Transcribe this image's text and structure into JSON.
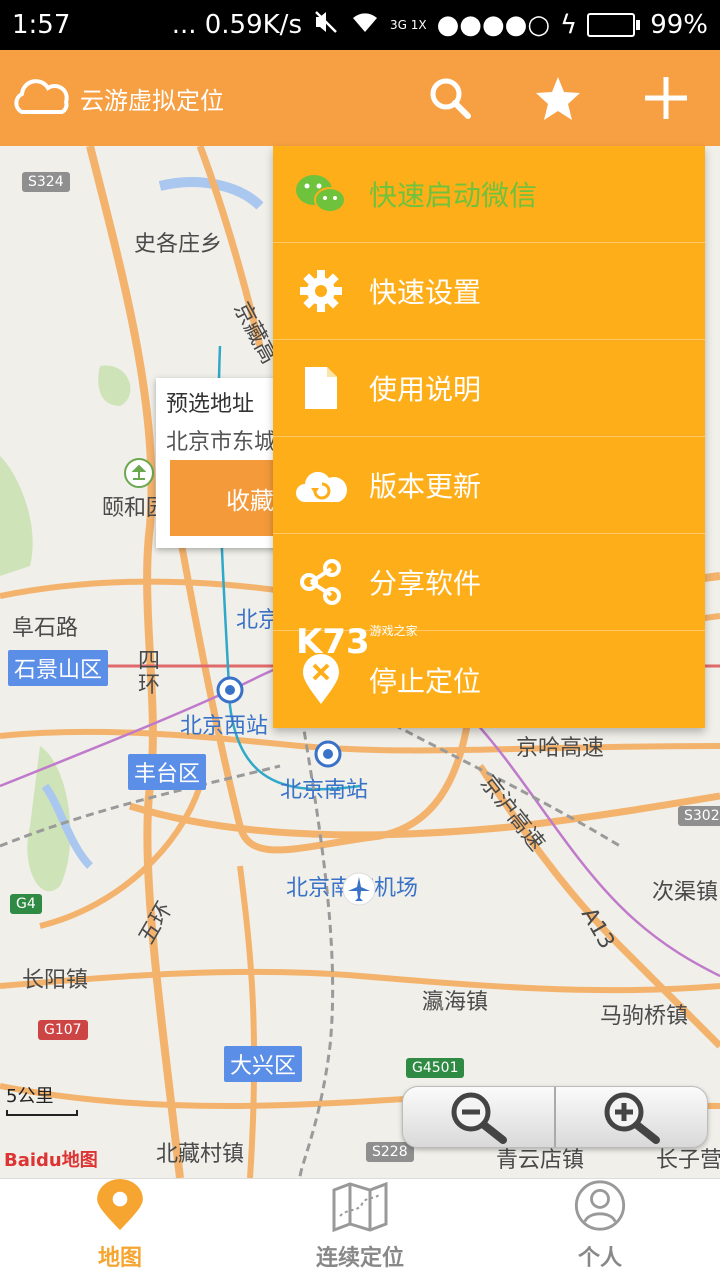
{
  "status_bar": {
    "time": "1:57",
    "network_speed": "... 0.59K/s",
    "signal": "3G 1X",
    "battery_percent": "99%",
    "battery_level": 0.99
  },
  "app_bar": {
    "title": "云游虚拟定位",
    "actions": [
      "search-icon",
      "star-icon",
      "plus-icon"
    ]
  },
  "menu": {
    "items": [
      {
        "label": "快速启动微信",
        "icon": "wechat-icon"
      },
      {
        "label": "快速设置",
        "icon": "gear-icon"
      },
      {
        "label": "使用说明",
        "icon": "document-icon"
      },
      {
        "label": "版本更新",
        "icon": "cloud-refresh-icon"
      },
      {
        "label": "分享软件",
        "icon": "share-icon"
      },
      {
        "label": "停止定位",
        "icon": "location-off-icon"
      }
    ]
  },
  "popup": {
    "line1": "预选地址",
    "line2": "北京市东城",
    "favorite_label": "收藏"
  },
  "map": {
    "labels": {
      "shishe": "史各庄乡",
      "jingzang": "京藏高",
      "yiheyuan": "颐和园",
      "fushilu": "阜石路",
      "shijingshan": "石景山区",
      "sihuan": "四环",
      "beijing_partial": "北京",
      "beijingxi": "北京西站",
      "fengtai": "丰台区",
      "beijingnan": "北京南站",
      "jinghagaosu": "京哈高速",
      "jinghu": "京沪高速",
      "nanyuan": "北京南苑机场",
      "ciqu": "次渠镇",
      "wuhuan": "五环",
      "changyang": "长阳镇",
      "yinghai": "瀛海镇",
      "majuqiao": "马驹桥镇",
      "daxing": "大兴区",
      "beizangcun": "北藏村镇",
      "qingyundian": "青云店镇",
      "changziying": "长子营",
      "a3": "A13"
    },
    "shields": {
      "s324": "S324",
      "s302": "S302",
      "g4": "G4",
      "g107": "G107",
      "g4501": "G4501",
      "s228": "S228"
    },
    "scale_label": "5公里",
    "attribution": "Baidu地图"
  },
  "watermark": {
    "main": "K73",
    "sub": "游戏之家"
  },
  "bottom_nav": {
    "tabs": [
      {
        "label": "地图",
        "icon": "map-pin-icon",
        "active": true
      },
      {
        "label": "连续定位",
        "icon": "folded-map-icon",
        "active": false
      },
      {
        "label": "个人",
        "icon": "user-icon",
        "active": false
      }
    ]
  },
  "colors": {
    "app_bar": "#f7a043",
    "menu_bg": "#feae19",
    "wechat_green": "#6ec23c",
    "active_tab": "#f6a530"
  }
}
